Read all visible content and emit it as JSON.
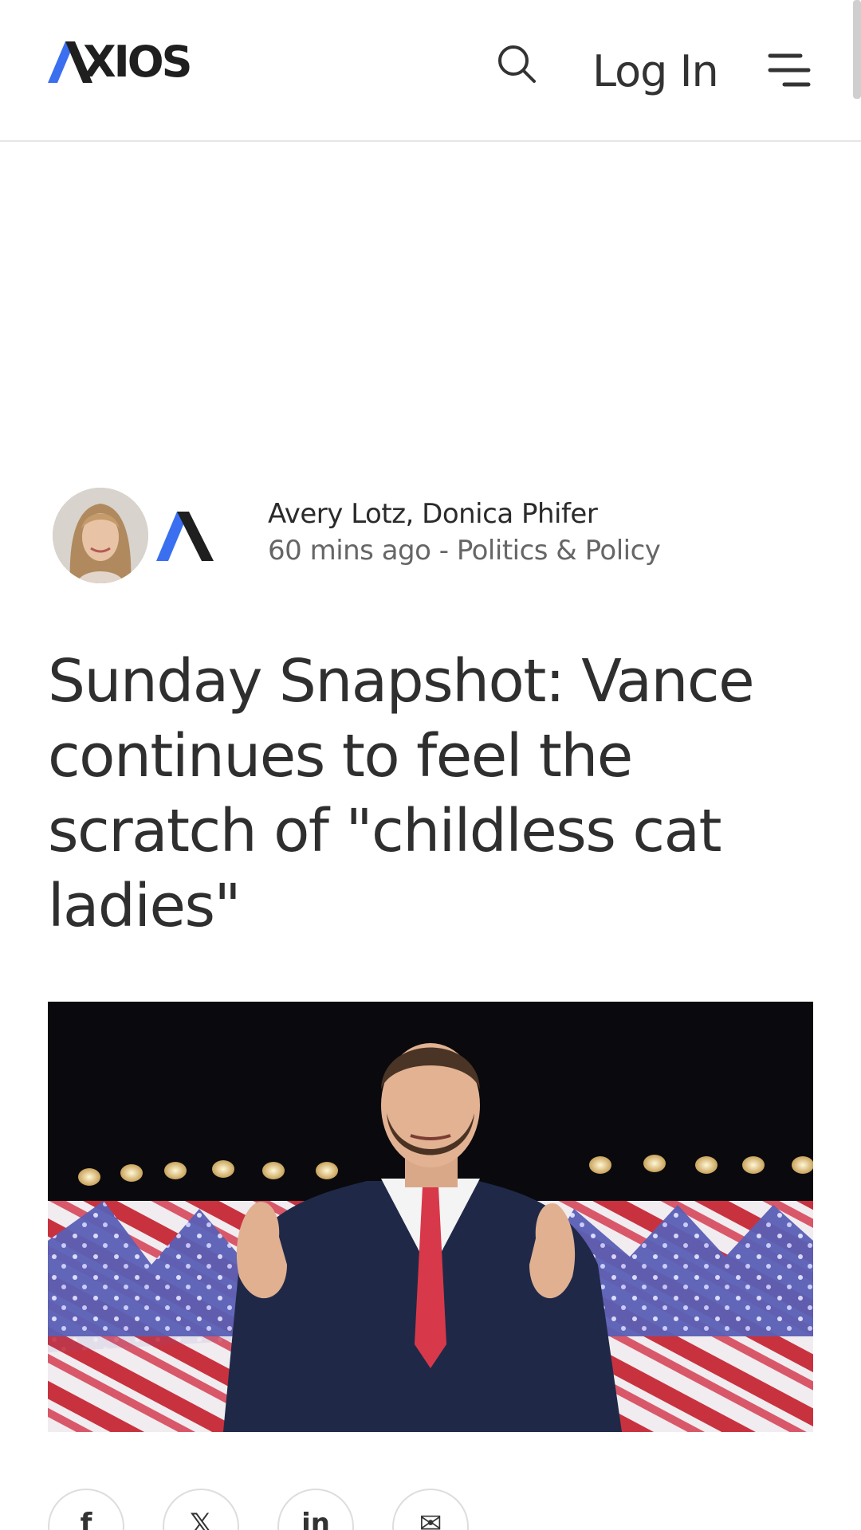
{
  "header": {
    "logo_text": "XIOS",
    "login_label": "Log In"
  },
  "icons": {
    "search": "search-icon",
    "menu": "hamburger-menu-icon",
    "share": [
      "facebook-icon",
      "x-icon",
      "linkedin-icon",
      "email-icon"
    ]
  },
  "byline": {
    "authors": "Avery Lotz, Donica Phifer",
    "time": "60 mins ago",
    "separator": " - ",
    "section": "Politics & Policy"
  },
  "article": {
    "headline": "Sunday Snapshot: Vance continues to feel the scratch of \"childless cat ladies\""
  },
  "share": {
    "facebook_glyph": "f",
    "x_glyph": "𝕏",
    "linkedin_glyph": "in",
    "email_glyph": "✉"
  },
  "colors": {
    "brand_blue": "#3a6ff0",
    "text_dark": "#2f2f2f",
    "text_muted": "#666666"
  }
}
